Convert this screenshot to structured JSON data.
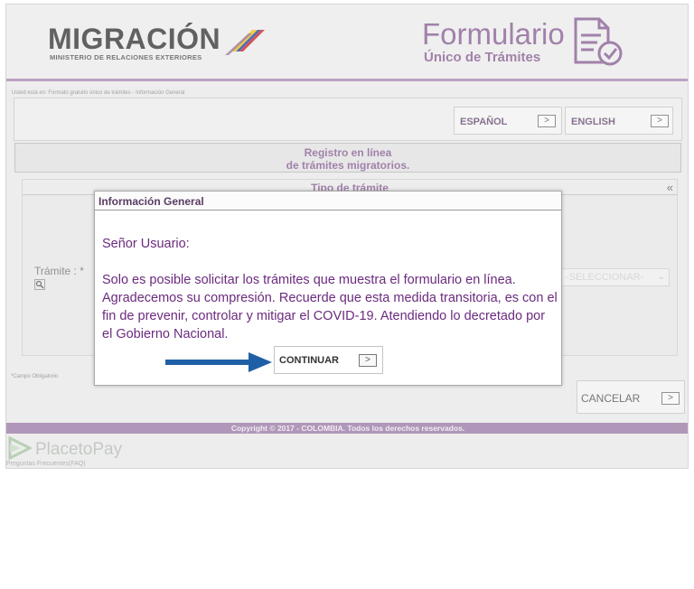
{
  "header": {
    "logo_word": "MIGRACIÓN",
    "logo_subtitle": "MINISTERIO DE RELACIONES EXTERIORES",
    "form_title": "Formulario",
    "form_subtitle": "Único de Trámites"
  },
  "breadcrumb": "Usted está en: Formato gratuito único de trámites - Información General",
  "language": {
    "spanish": "ESPAÑOL",
    "english": "ENGLISH",
    "arrow": ">"
  },
  "registro": {
    "line1": "Registro en línea",
    "line2": "de trámites migratorios."
  },
  "tipo": {
    "title": "Tipo de trámite",
    "collapse": "«",
    "tramite_label": "Trámite : *",
    "select_value": "-SELECCIONAR-"
  },
  "campo_obligatorio": "*Campo Obligatorio",
  "cancel": "CANCELAR",
  "footer": {
    "copyright": "Copyright © 2017 - COLOMBIA. Todos los derechos reservados.",
    "placetopay": "PlacetoPay",
    "faq": "Preguntas Frecuentes(FAQ)"
  },
  "modal": {
    "title": "Información General",
    "greeting": "Señor Usuario:",
    "message": "Solo es posible solicitar los trámites que muestra el formulario en línea. Agradecemos su compresión. Recuerde que esta medida transitoria, es con el fin de prevenir, controlar y mitigar el COVID-19. Atendiendo lo decretado por el Gobierno Nacional.",
    "continue": "CONTINUAR"
  },
  "colors": {
    "brand_purple": "#8a6295",
    "text_purple": "#6b2b7e",
    "arrow_blue": "#1f5fa6"
  }
}
